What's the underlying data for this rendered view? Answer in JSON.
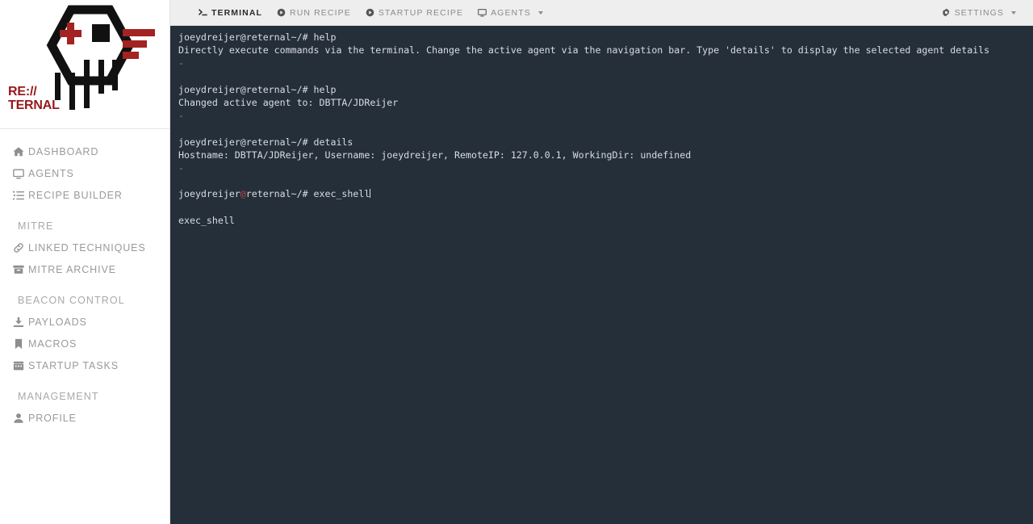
{
  "brand": {
    "name": "RE://TERNAL",
    "line1": "RE://",
    "line2": "TERNAL",
    "logo_icon": "hex-skull-logo",
    "accent_red": "#96181d",
    "logo_dash_red": "#a32222"
  },
  "sidebar": {
    "items": [
      {
        "label": "DASHBOARD",
        "icon": "home-icon",
        "name": "sidebar-item-dashboard"
      },
      {
        "label": "AGENTS",
        "icon": "monitor-icon",
        "name": "sidebar-item-agents"
      },
      {
        "label": "RECIPE BUILDER",
        "icon": "list-icon",
        "name": "sidebar-item-recipe-builder"
      }
    ],
    "sections": [
      {
        "title": "MITRE",
        "items": [
          {
            "label": "LINKED TECHNIQUES",
            "icon": "link-icon",
            "name": "sidebar-item-linked-techniques"
          },
          {
            "label": "MITRE ARCHIVE",
            "icon": "archive-icon",
            "name": "sidebar-item-mitre-archive"
          }
        ]
      },
      {
        "title": "BEACON CONTROL",
        "items": [
          {
            "label": "PAYLOADS",
            "icon": "download-icon",
            "name": "sidebar-item-payloads"
          },
          {
            "label": "MACROS",
            "icon": "bookmark-icon",
            "name": "sidebar-item-macros"
          },
          {
            "label": "STARTUP TASKS",
            "icon": "calendar-icon",
            "name": "sidebar-item-startup-tasks"
          }
        ]
      },
      {
        "title": "MANAGEMENT",
        "items": [
          {
            "label": "PROFILE",
            "icon": "user-icon",
            "name": "sidebar-item-profile"
          }
        ]
      }
    ]
  },
  "topbar": {
    "items": [
      {
        "label": "TERMINAL",
        "icon": "terminal-prompt-icon",
        "active": true,
        "name": "topbar-tab-terminal"
      },
      {
        "label": "RUN RECIPE",
        "icon": "play-circle-icon",
        "active": false,
        "name": "topbar-tab-run-recipe"
      },
      {
        "label": "STARTUP RECIPE",
        "icon": "play-circle-icon",
        "active": false,
        "name": "topbar-tab-startup-recipe"
      },
      {
        "label": "AGENTS",
        "icon": "monitor-icon",
        "active": false,
        "caret": true,
        "name": "topbar-tab-agents"
      }
    ],
    "settings": {
      "label": "SETTINGS",
      "icon": "gear-icon",
      "caret": true,
      "name": "topbar-settings"
    }
  },
  "terminal": {
    "background_color": "#252f3a",
    "text_color": "#d8dde3",
    "at_color": "#b4494f",
    "prompt_user": "joeydreijer",
    "prompt_host": "reternal",
    "prompt_suffix": "~/#",
    "lines": [
      {
        "type": "prompt",
        "command": " help"
      },
      {
        "type": "output",
        "text": "Directly execute commands via the terminal. Change the active agent via the navigation bar. Type 'details' to display the selected agent details"
      },
      {
        "type": "separator",
        "text": "-"
      },
      {
        "type": "blank",
        "text": ""
      },
      {
        "type": "prompt",
        "command": " help"
      },
      {
        "type": "output",
        "text": "Changed active agent to: DBTTA/JDReijer"
      },
      {
        "type": "separator",
        "text": "-"
      },
      {
        "type": "blank",
        "text": ""
      },
      {
        "type": "prompt",
        "command": " details"
      },
      {
        "type": "output",
        "text": "Hostname: DBTTA/JDReijer, Username: joeydreijer, RemoteIP: 127.0.0.1, WorkingDir: undefined"
      },
      {
        "type": "separator",
        "text": "-"
      },
      {
        "type": "blank",
        "text": ""
      },
      {
        "type": "active-prompt",
        "command": " exec_shell"
      },
      {
        "type": "blank",
        "text": ""
      },
      {
        "type": "output",
        "text": "exec_shell"
      }
    ]
  }
}
